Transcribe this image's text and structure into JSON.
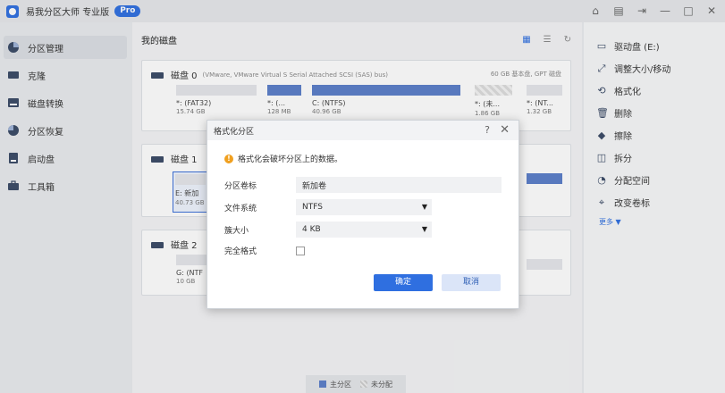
{
  "app": {
    "title": "易我分区大师",
    "edition": "专业版",
    "badge": "Pro"
  },
  "window_controls": [
    "hat-icon",
    "note-icon",
    "export-icon",
    "minimize-icon",
    "maximize-icon",
    "close-icon"
  ],
  "sidebar": {
    "items": [
      {
        "label": "分区管理",
        "icon": "pie-chart-icon",
        "active": true
      },
      {
        "label": "克隆",
        "icon": "clone-icon"
      },
      {
        "label": "磁盘转换",
        "icon": "disk-convert-icon"
      },
      {
        "label": "分区恢复",
        "icon": "partition-recovery-icon"
      },
      {
        "label": "启动盘",
        "icon": "boot-disk-icon"
      },
      {
        "label": "工具箱",
        "icon": "toolbox-icon"
      }
    ]
  },
  "main": {
    "title": "我的磁盘",
    "disks": [
      {
        "name": "磁盘 0",
        "desc": "(VMware,  VMware Virtual S Serial Attached SCSI (SAS) bus)",
        "meta": "60 GB 基本盘, GPT 磁盘",
        "partitions": [
          {
            "label": "*: (FAT32)",
            "size": "15.74 GB",
            "fill": 0
          },
          {
            "label": "*: (...",
            "size": "128 MB",
            "fill": 1
          },
          {
            "label": "C: (NTFS)",
            "size": "40.96 GB",
            "fill": 1
          },
          {
            "label": "*: (未...",
            "size": "1.86 GB",
            "fill": 0
          },
          {
            "label": "*: (NT...",
            "size": "1.32 GB",
            "fill": 0
          }
        ]
      },
      {
        "name": "磁盘 1",
        "partitions": [
          {
            "label": "E: 新加",
            "size": "40.73 GB",
            "fill": 0
          }
        ]
      },
      {
        "name": "磁盘 2",
        "partitions": [
          {
            "label": "G: (NTF",
            "size": "10 GB",
            "fill": 0
          }
        ]
      }
    ]
  },
  "legend": {
    "primary": "主分区",
    "unallocated": "未分配",
    "primary_color": "#5b7ec9"
  },
  "right_panel": {
    "header": "驱动盘 (E:)",
    "ops": [
      {
        "label": "调整大小/移动",
        "icon": "resize-icon"
      },
      {
        "label": "格式化",
        "icon": "format-icon"
      },
      {
        "label": "删除",
        "icon": "trash-icon"
      },
      {
        "label": "擦除",
        "icon": "eraser-icon"
      },
      {
        "label": "拆分",
        "icon": "split-icon"
      },
      {
        "label": "分配空间",
        "icon": "allocate-icon"
      },
      {
        "label": "改变卷标",
        "icon": "tag-icon"
      }
    ],
    "more": "更多 ▼"
  },
  "dialog": {
    "title": "格式化分区",
    "warning": "格式化会破坏分区上的数据。",
    "fields": {
      "volume_label": {
        "label": "分区卷标",
        "value": "新加卷"
      },
      "filesystem": {
        "label": "文件系统",
        "value": "NTFS"
      },
      "cluster_size": {
        "label": "簇大小",
        "value": "4 KB"
      },
      "full_format": {
        "label": "完全格式",
        "checked": false
      }
    },
    "ok": "确定",
    "cancel": "取消"
  }
}
